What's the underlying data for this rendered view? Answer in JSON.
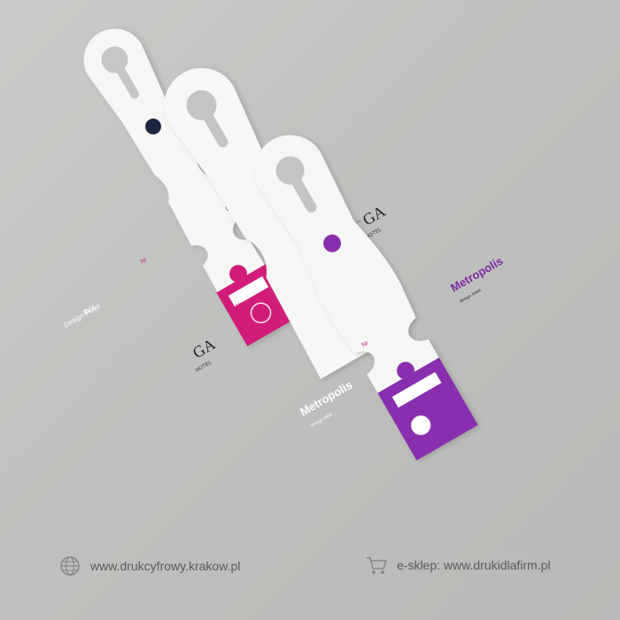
{
  "tags": {
    "inx": {
      "brand": "INX",
      "sub": "Design Hotel",
      "field_label": "Nr",
      "accent": "#d11f7a"
    },
    "ga": {
      "brand": "GA",
      "sub": "HOTEL",
      "field_label": "Nr",
      "accent": "#222222"
    },
    "metropolis": {
      "brand": "Metropolis",
      "sub": "design hotel",
      "field_label": "Nr",
      "accent": "#8a2fb0"
    }
  },
  "footer": {
    "website": "www.drukcyfrowy.krakow.pl",
    "shop": "e-sklep: www.drukidlafirm.pl",
    "globe_icon": "globe-icon",
    "cart_icon": "cart-icon"
  }
}
